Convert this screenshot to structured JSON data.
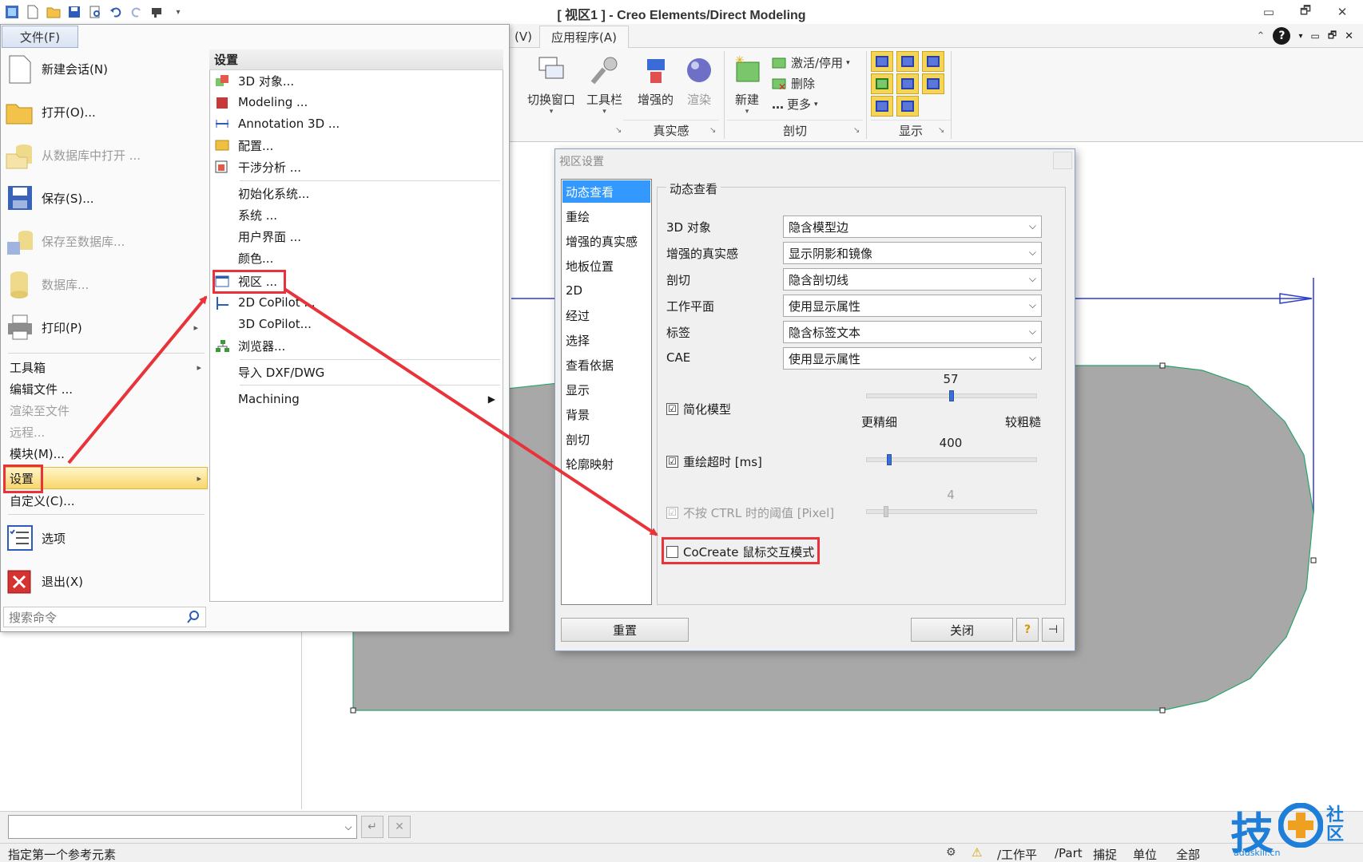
{
  "window": {
    "title": "[ 视区1 ] - Creo Elements/Direct Modeling",
    "controls": [
      "▭",
      "🗗",
      "✕"
    ]
  },
  "ribbon": {
    "tabs": {
      "view": "(V)",
      "app": "应用程序(A)"
    },
    "buttons": {
      "switch_window": "切换窗口",
      "toolbar": "工具栏",
      "enhanced": "增强的",
      "render": "渲染",
      "new": "新建",
      "activate": "激活/停用",
      "delete": "删除",
      "more": "更多"
    },
    "groups": {
      "realism": "真实感",
      "section": "剖切",
      "display": "显示"
    }
  },
  "filemenu": {
    "tab": "文件(F)",
    "items": {
      "new_session": "新建会话(N)",
      "open": "打开(O)...",
      "open_db": "从数据库中打开 ...",
      "save": "保存(S)...",
      "save_db": "保存至数据库...",
      "database": "数据库...",
      "print": "打印(P)"
    },
    "text_items": {
      "toolbox": "工具箱",
      "edit_file": "编辑文件 ...",
      "render_file": "渲染至文件",
      "remote": "远程...",
      "module": "模块(M)...",
      "settings": "设置",
      "customize": "自定义(C)..."
    },
    "options": "选项",
    "exit": "退出(X)",
    "search_placeholder": "搜索命令"
  },
  "submenu": {
    "header": "设置",
    "items": {
      "obj3d": "3D 对象...",
      "modeling": "Modeling ...",
      "annotation": "Annotation 3D ...",
      "config": "配置...",
      "interference": "干涉分析 ...",
      "init": "初始化系统...",
      "system": "系统 ...",
      "ui": "用户界面 ...",
      "color": "颜色...",
      "viewport": "视区 ...",
      "copilot2d": "2D CoPilot ...",
      "copilot3d": "3D CoPilot...",
      "browser": "浏览器...",
      "import": "导入 DXF/DWG",
      "machining": "Machining"
    }
  },
  "dialog": {
    "title": "视区设置",
    "nav": [
      "动态查看",
      "重绘",
      "增强的真实感",
      "地板位置",
      "2D",
      "经过",
      "选择",
      "查看依据",
      "显示",
      "背景",
      "剖切",
      "轮廓映射"
    ],
    "group_title": "动态查看",
    "rows": [
      {
        "label": "3D 对象",
        "value": "隐含模型边"
      },
      {
        "label": "增强的真实感",
        "value": "显示阴影和镜像"
      },
      {
        "label": "剖切",
        "value": "隐含剖切线"
      },
      {
        "label": "工作平面",
        "value": "使用显示属性"
      },
      {
        "label": "标签",
        "value": "隐含标签文本"
      },
      {
        "label": "CAE",
        "value": "使用显示属性"
      }
    ],
    "simplify": {
      "label": "简化模型",
      "checked": "☑",
      "value": "57",
      "finer": "更精细",
      "coarser": "较粗糙",
      "level": 0.5
    },
    "redraw_timeout": {
      "label": "重绘超时 [ms]",
      "checked": "☑",
      "value": "400",
      "level": 0.12
    },
    "ctrl_threshold": {
      "label": "不按 CTRL 时的阈值 [Pixel]",
      "checked": "☑",
      "value": "4",
      "level": 0.1
    },
    "cocreate": {
      "label": "CoCreate 鼠标交互模式",
      "checked": ""
    },
    "buttons": {
      "reset": "重置",
      "close": "关闭",
      "help": "?",
      "pin": "⊣"
    }
  },
  "status": {
    "prompt": "指定第一个参考元素",
    "fields": [
      "/工作平",
      "/Part",
      "捕捉",
      "单位",
      "全部"
    ]
  },
  "watermark": {
    "text1": "技",
    "text2": "社区",
    "url": "addskill.cn"
  },
  "colors": {
    "highlight_red": "#e8333a",
    "selection_blue": "#3399ff",
    "settings_gold": "#f8d66c",
    "shape_gray": "#a8a8a8",
    "shape_edge": "#2aa36b"
  }
}
